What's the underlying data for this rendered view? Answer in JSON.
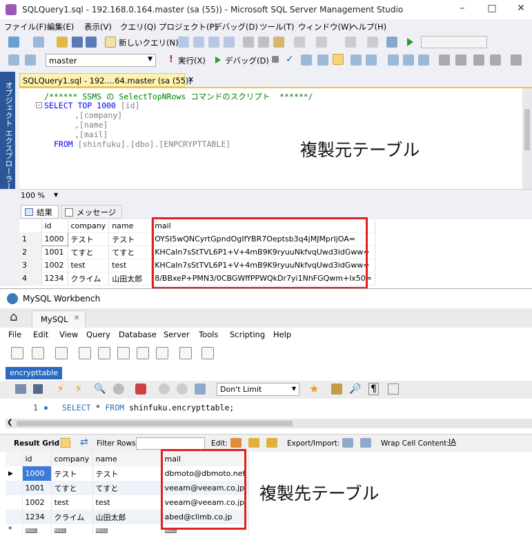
{
  "ssms": {
    "title": "SQLQuery1.sql - 192.168.0.164.master (sa (55)) - Microsoft SQL Server Management Studio",
    "menu": [
      "ファイル(F)",
      "編集(E)",
      "表示(V)",
      "クエリ(Q)",
      "プロジェクト(P)",
      "デバッグ(D)",
      "ツール(T)",
      "ウィンドウ(W)",
      "ヘルプ(H)"
    ],
    "new_query_label": "新しいクエリ(N)",
    "database": "master",
    "execute_label": "実行(X)",
    "debug_label": "デバッグ(D)",
    "side_tab": "オブジェクト エクスプローラー",
    "doc_tab": "SQLQuery1.sql - 192....64.master (sa (55))",
    "code": {
      "comment": "/****** SSMS の SelectTopNRows コマンドのスクリプト  ******/",
      "l1_kw": "SELECT TOP 1000",
      "l1_col": "[id]",
      "l2": ",[company]",
      "l3": ",[name]",
      "l4": ",[mail]",
      "l5_kw": "FROM",
      "l5_tbl": "[shinfuku].[dbo].[ENPCRYPTTABLE]"
    },
    "source_label": "複製元テーブル",
    "zoom": "100 %",
    "tabs": {
      "results": "結果",
      "messages": "メッセージ"
    },
    "columns": [
      "id",
      "company",
      "name",
      "mail"
    ],
    "rows": [
      {
        "n": "1",
        "id": "1000",
        "company": "テスト",
        "name": "テスト",
        "mail": "OYSI5wQNCyrtGpndOgIfYBR7Oeptsb3q4jMJMprIjOA="
      },
      {
        "n": "2",
        "id": "1001",
        "company": "てすと",
        "name": "てすと",
        "mail": "KHCaIn7sStTVL6P1+V+4mB9K9ryuuNkfvqUwd3idGww="
      },
      {
        "n": "3",
        "id": "1002",
        "company": "test",
        "name": "test",
        "mail": "KHCaIn7sStTVL6P1+V+4mB9K9ryuuNkfvqUwd3idGww="
      },
      {
        "n": "4",
        "id": "1234",
        "company": "クライム",
        "name": "山田太郎",
        "mail": "8/BBxeP+PMN3/0CBGWffPPWQkDr7yi1NhFGQwm+lx50="
      }
    ]
  },
  "wb": {
    "title": "MySQL Workbench",
    "conn_tab": "MySQL",
    "menu": [
      "File",
      "Edit",
      "View",
      "Query",
      "Database",
      "Server",
      "Tools",
      "Scripting",
      "Help"
    ],
    "editor_tab": "encrypttable",
    "limit": "Don't Limit",
    "line_no": "1",
    "sql_kw1": "SELECT",
    "sql_mid": "* ",
    "sql_kw2": "FROM",
    "sql_rest": "shinfuku.encrypttable;",
    "result_grid": "Result Grid",
    "filter_rows": "Filter Rows:",
    "edit": "Edit:",
    "export": "Export/Import:",
    "wrap": "Wrap Cell Content:",
    "columns": [
      "id",
      "company",
      "name",
      "mail"
    ],
    "rows": [
      {
        "id": "1000",
        "company": "テスト",
        "name": "テスト",
        "mail": "dbmoto@dbmoto.net"
      },
      {
        "id": "1001",
        "company": "てすと",
        "name": "てすと",
        "mail": "veeam@veeam.co.jp"
      },
      {
        "id": "1002",
        "company": "test",
        "name": "test",
        "mail": "veeam@veeam.co.jp"
      },
      {
        "id": "1234",
        "company": "クライム",
        "name": "山田太郎",
        "mail": "abed@climb.co.jp"
      }
    ],
    "null": "NULL",
    "new_row_marker": "*",
    "dest_label": "複製先テーブル"
  }
}
